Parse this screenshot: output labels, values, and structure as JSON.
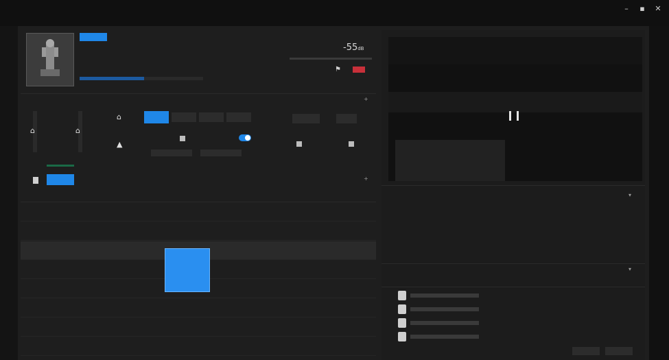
{
  "window": {
    "title": "",
    "menu": [
      "",
      "",
      "",
      ""
    ],
    "controls": [
      "–",
      "▪",
      "✕"
    ]
  },
  "header": {
    "name": "",
    "subtitle": "",
    "meta": "",
    "line3": "",
    "level_value": "-55",
    "level_unit": "dB",
    "progress": 0.52
  },
  "controls": {
    "section_label": "",
    "modes": [
      "",
      "",
      "",
      ""
    ],
    "mode_tabs": [
      "",
      "",
      ""
    ],
    "chip": "",
    "toggles": [
      {
        "label": "",
        "on": false
      },
      {
        "label": "",
        "on": true
      },
      {
        "label": "",
        "on": false
      },
      {
        "label": "",
        "on": false
      }
    ]
  },
  "tabs": {
    "active": "",
    "second": "",
    "right_action": ""
  },
  "table": {
    "columns": [
      "",
      "",
      "",
      "",
      ""
    ],
    "rows": [
      {
        "name": "",
        "c2": "",
        "c3": "",
        "c4": "",
        "c5": ""
      },
      {
        "name": "",
        "c2": "",
        "c3": "",
        "c4": "",
        "c5": ""
      },
      {
        "name": "",
        "c2": "",
        "c3": "",
        "c4": "",
        "c5": ""
      },
      {
        "name": "",
        "c2": "",
        "c3": "",
        "c4": "",
        "c5": ""
      },
      {
        "name": "",
        "c2": "",
        "c3": "",
        "c4": "",
        "c5": ""
      },
      {
        "name": "",
        "c2": "",
        "c3": "",
        "c4": "",
        "c5": ""
      },
      {
        "name": "",
        "c2": "",
        "c3": "",
        "c4": "",
        "c5": ""
      },
      {
        "name": "",
        "c2": "",
        "c3": "",
        "c4": "",
        "c5": ""
      }
    ],
    "dropdown_options": [
      "",
      "",
      ""
    ]
  },
  "preview": {
    "pause_icon": "pause-icon"
  },
  "props": {
    "section_title": "",
    "items": [
      {
        "label": "",
        "value": ""
      },
      {
        "label": "",
        "value": ""
      },
      {
        "label": "",
        "value": ""
      },
      {
        "label": "",
        "value": ""
      },
      {
        "label": "",
        "value": ""
      }
    ],
    "files_section": "",
    "files_columns": [
      "",
      "",
      "",
      "",
      ""
    ],
    "files": [
      {
        "name": "",
        "c2": "",
        "c3": ""
      },
      {
        "name": "",
        "c2": "",
        "c3": ""
      },
      {
        "name": "",
        "c2": "",
        "c3": ""
      },
      {
        "name": "",
        "c2": "",
        "c3": ""
      }
    ],
    "footer_buttons": [
      "",
      ""
    ]
  }
}
